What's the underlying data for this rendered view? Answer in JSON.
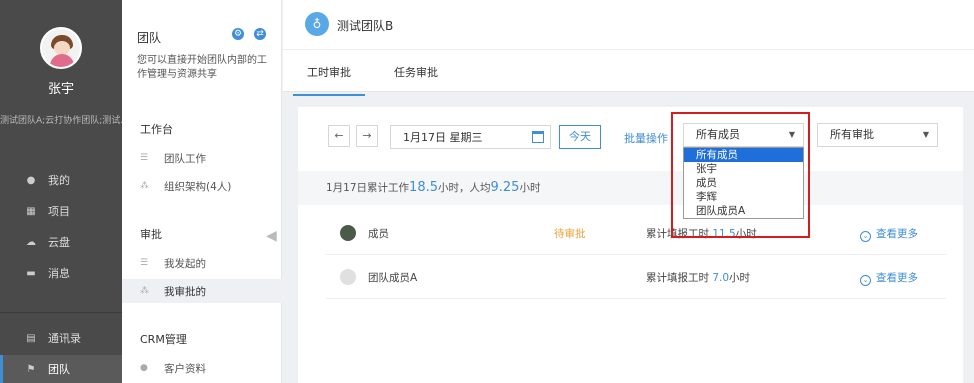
{
  "user": {
    "name": "张宇",
    "teams": "测试团队A;云打协作团队;测试..."
  },
  "nav": [
    {
      "label": "我的",
      "icon": "person-icon"
    },
    {
      "label": "项目",
      "icon": "grid-icon"
    },
    {
      "label": "云盘",
      "icon": "cloud-icon"
    },
    {
      "label": "消息",
      "icon": "chat-icon"
    },
    {
      "label": "通讯录",
      "icon": "contacts-icon"
    },
    {
      "label": "团队",
      "icon": "flag-icon"
    }
  ],
  "sub": {
    "title": "团队",
    "description": "您可以直接开始团队内部的工作管理与资源共享",
    "workbench": "工作台",
    "team_work": "团队工作",
    "org": "组织架构(4人)",
    "approval": "审批",
    "initiated": "我发起的",
    "approved_by_me": "我审批的",
    "crm": "CRM管理",
    "customers": "客户资料"
  },
  "header": {
    "team_name": "测试团队B"
  },
  "tabs": [
    "工时审批",
    "任务审批"
  ],
  "toolbar": {
    "date": "1月17日 星期三",
    "today": "今天",
    "batch": "批量操作",
    "member_select": "所有成员",
    "approval_select": "所有审批"
  },
  "dropdown_options": [
    "所有成员",
    "张宇",
    "成员",
    "李辉",
    "团队成员A"
  ],
  "summary": {
    "prefix": "1月17日累计工作",
    "total": "18.5",
    "mid": "小时，人均",
    "avg": "9.25",
    "suffix": "小时"
  },
  "rows": [
    {
      "name": "成员",
      "status": "待审批",
      "hours_label": "累计填报工时",
      "hours": "11.5",
      "unit": "小时",
      "more": "查看更多"
    },
    {
      "name": "团队成员A",
      "status": "",
      "hours_label": "累计填报工时",
      "hours": "7.0",
      "unit": "小时",
      "more": "查看更多"
    }
  ],
  "colors": {
    "accent": "#3e8ed8",
    "pending": "#e8a23a",
    "highlight": "#d21e1e"
  }
}
